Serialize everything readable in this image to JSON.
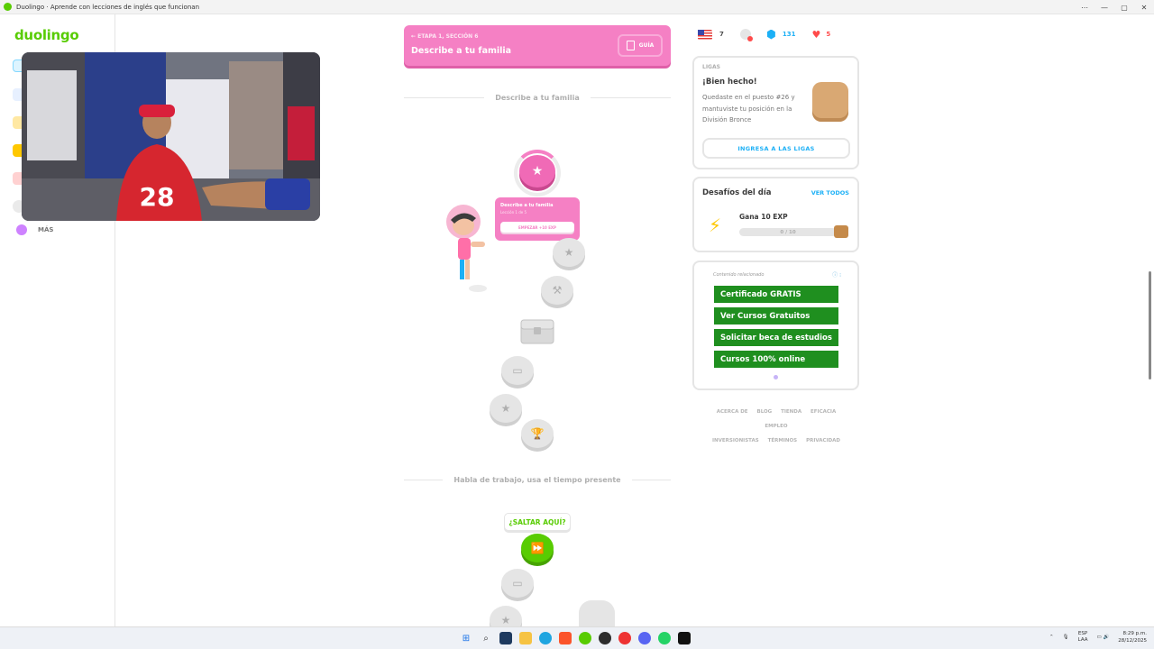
{
  "window": {
    "title": "Duolingo · Aprende con lecciones de inglés que funcionan",
    "controls": [
      "⋯",
      "—",
      "▢",
      "✕"
    ]
  },
  "sidebar": {
    "logo": "duolingo",
    "more_label": "MÁS"
  },
  "unit": {
    "subtitle": "ETAPA 1, SECCIÓN 6",
    "title": "Describe a tu familia",
    "guide_label": "GUÍA"
  },
  "path": {
    "section_title": "Describe a tu familia",
    "next_section_title": "Habla de trabajo, usa el tiempo presente",
    "tooltip": {
      "title": "Describe a tu familia",
      "progress": "Lección 1 de 5",
      "button": "EMPEZAR +10 EXP"
    },
    "skip_label": "¿SALTAR AQUÍ?"
  },
  "stats": {
    "streak_flag": "english",
    "gems_warning": "",
    "gems_count": "131",
    "hearts": "5",
    "lesson_count": "7"
  },
  "leagues": {
    "label": "LIGAS",
    "heading": "¡Bien hecho!",
    "text": "Quedaste en el puesto #26 y mantuviste tu posición en la División Bronce",
    "button": "INGRESA A LAS LIGAS"
  },
  "quests": {
    "heading": "Desafíos del día",
    "view_all": "VER TODOS",
    "quest_title": "Gana 10 EXP",
    "progress_text": "0 / 10",
    "progress_value": 0
  },
  "ads": {
    "label": "Contenido relacionado",
    "info": "ⓘ ⁝",
    "buttons": [
      "Certificado GRATIS",
      "Ver Cursos Gratuitos",
      "Solicitar beca de estudios",
      "Cursos 100% online"
    ]
  },
  "footer": {
    "links": [
      "ACERCA DE",
      "BLOG",
      "TIENDA",
      "EFICACIA",
      "EMPLEO",
      "INVERSIONISTAS",
      "TÉRMINOS",
      "PRIVACIDAD"
    ]
  },
  "taskbar": {
    "lang_top": "ESP",
    "lang_bottom": "LAA",
    "time": "8:29 p.m.",
    "date": "28/12/2025"
  },
  "colors": {
    "brand_green": "#58cc02",
    "unit_pink": "#f580c4",
    "link_blue": "#1cb0f6",
    "ad_green": "#1f8f1f"
  }
}
